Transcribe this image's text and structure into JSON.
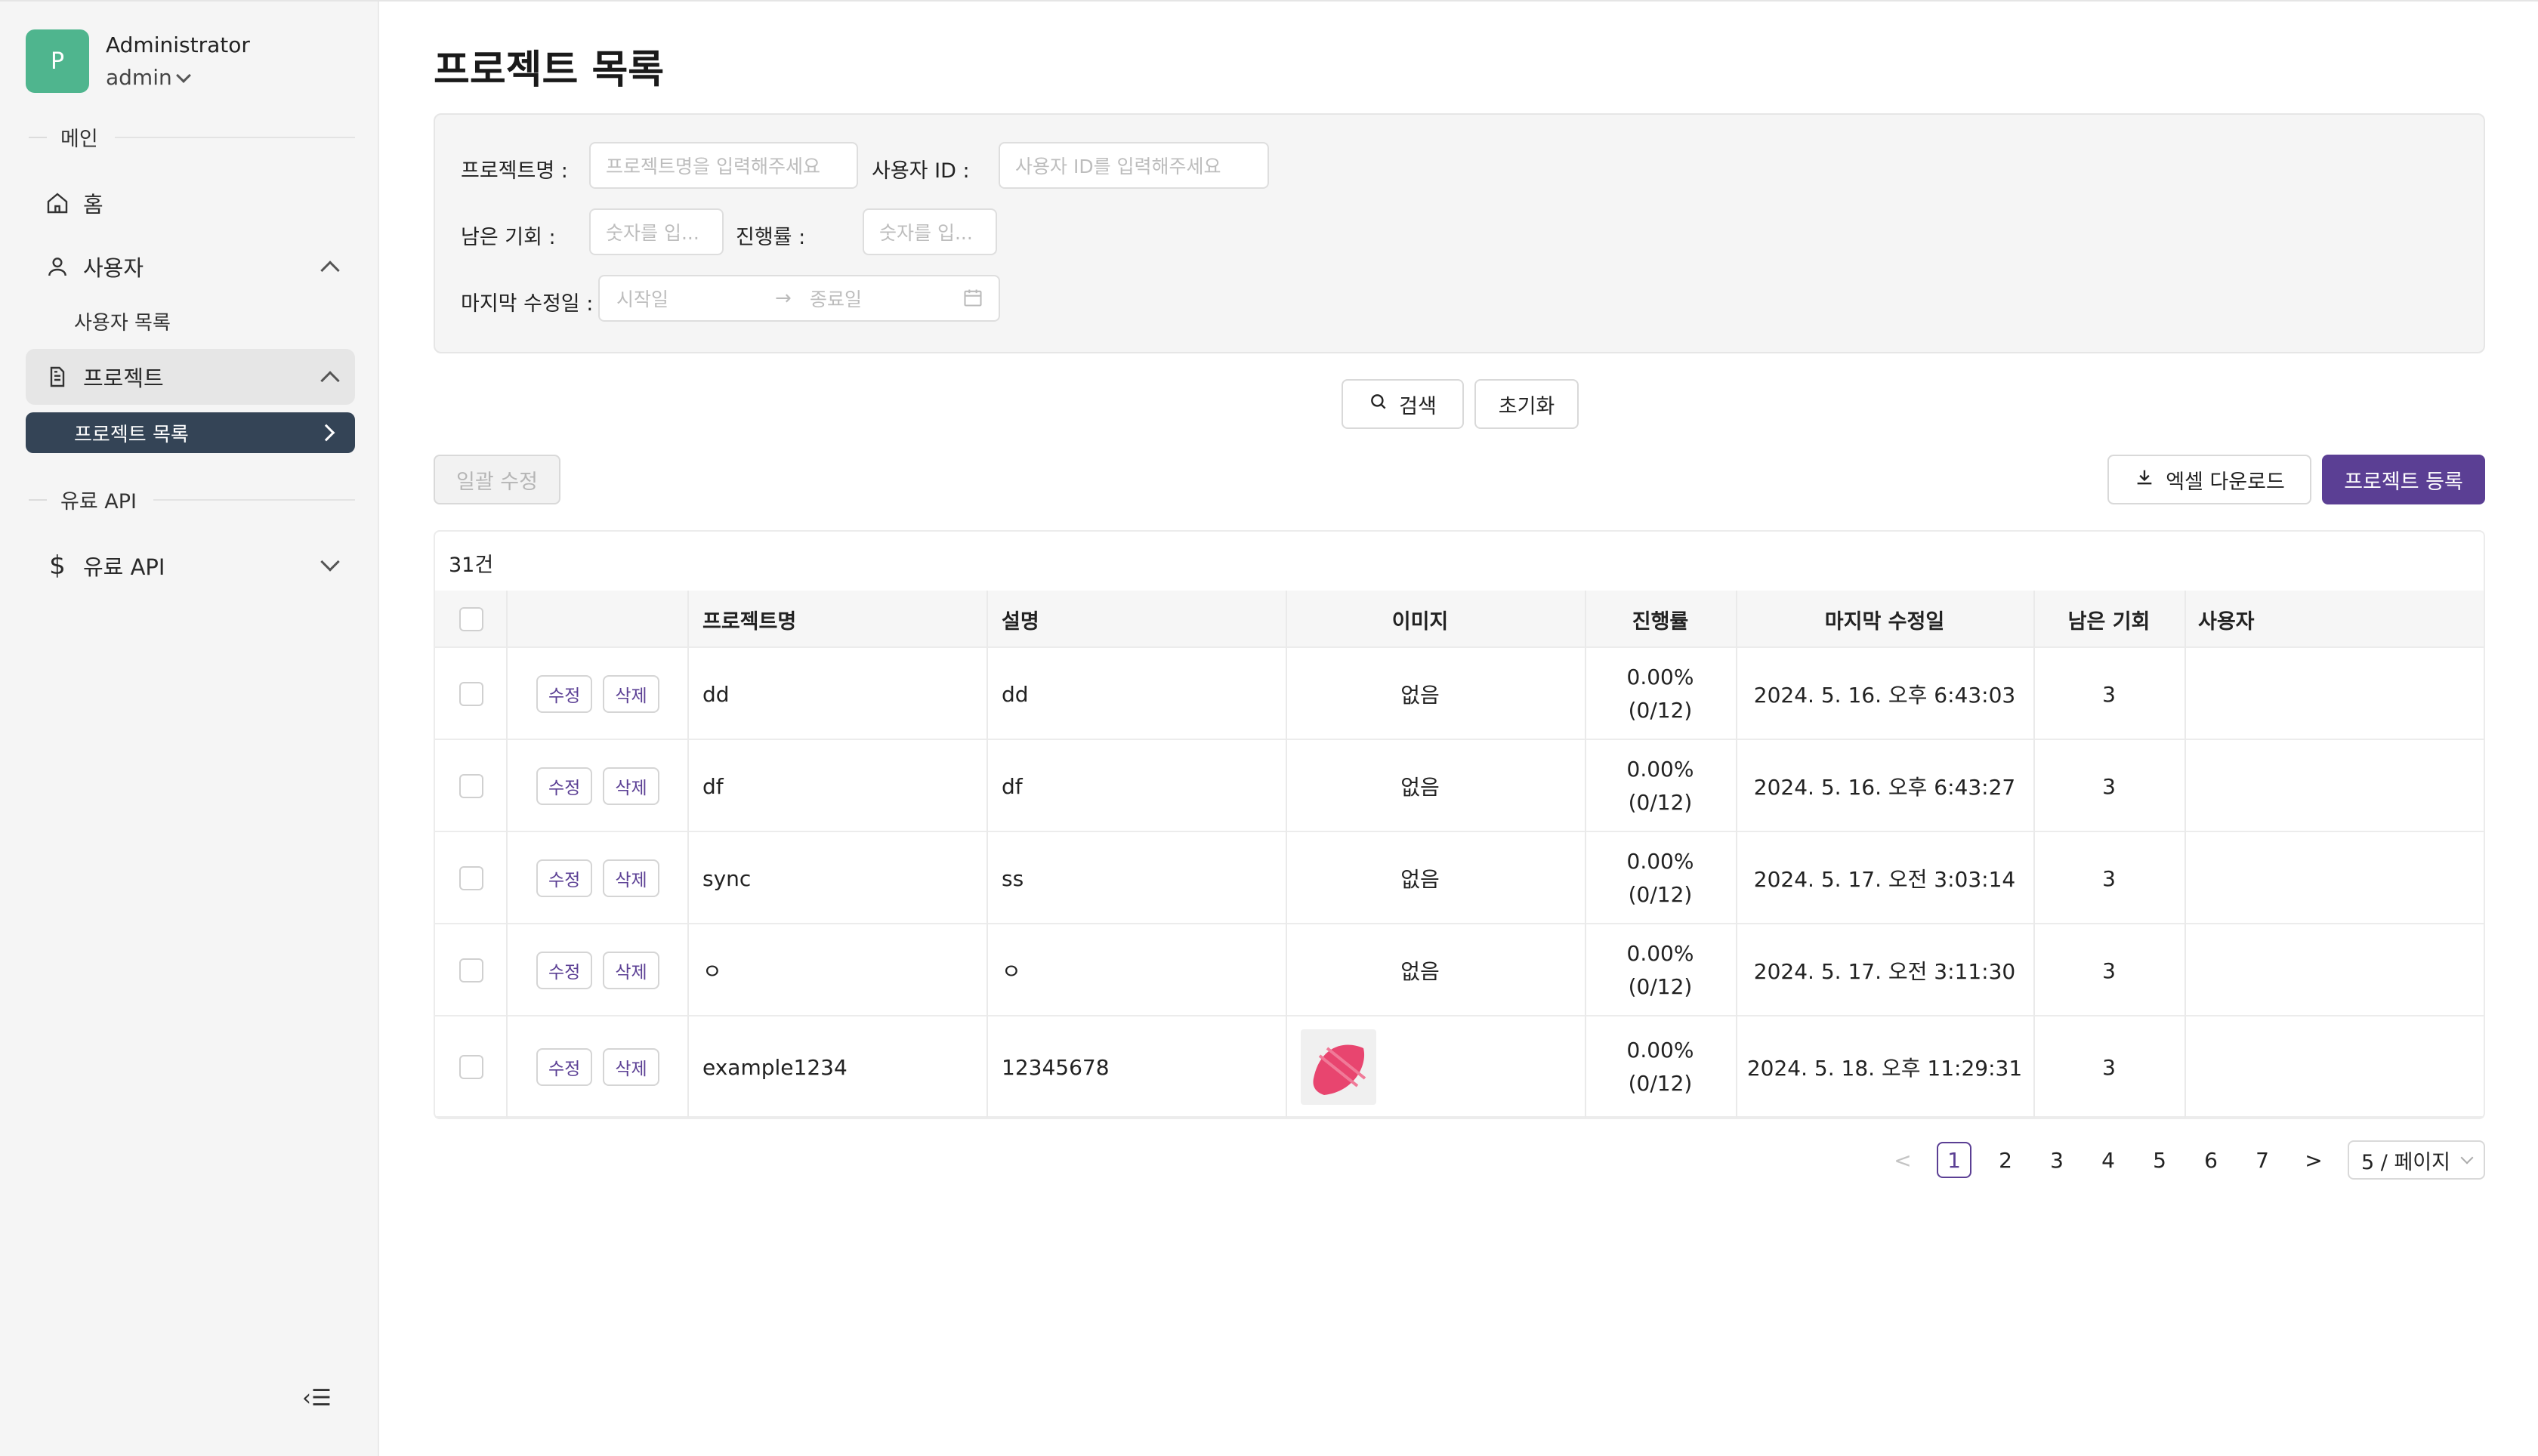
{
  "sidebar": {
    "avatar_letter": "P",
    "user_name": "Administrator",
    "user_id": "admin",
    "groups": {
      "main": "메인",
      "paid_api": "유료 API"
    },
    "items": {
      "home": "홈",
      "users": "사용자",
      "user_list": "사용자 목록",
      "projects": "프로젝트",
      "project_list": "프로젝트 목록",
      "paid_api": "유료 API"
    },
    "collapse_label": "‹☰"
  },
  "page": {
    "title": "프로젝트 목록"
  },
  "filters": {
    "project_name_label": "프로젝트명 :",
    "project_name_placeholder": "프로젝트명을 입력해주세요",
    "user_id_label": "사용자 ID :",
    "user_id_placeholder": "사용자 ID를 입력해주세요",
    "remaining_label": "남은 기회 :",
    "remaining_placeholder": "숫자를 입...",
    "progress_label": "진행률 :",
    "progress_placeholder": "숫자를 입...",
    "modified_label": "마지막 수정일 :",
    "start_placeholder": "시작일",
    "end_placeholder": "종료일"
  },
  "actions": {
    "search": "검색",
    "reset": "초기화",
    "bulk_edit": "일괄 수정",
    "excel_download": "엑셀 다운로드",
    "register": "프로젝트 등록"
  },
  "table": {
    "count": "31건",
    "columns": [
      "프로젝트명",
      "설명",
      "이미지",
      "진행률",
      "마지막 수정일",
      "남은 기회",
      "사용자"
    ],
    "edit_label": "수정",
    "delete_label": "삭제",
    "rows": [
      {
        "name": "dd",
        "desc": "dd",
        "image": "없음",
        "progress_pct": "0.00%",
        "progress_ratio": "(0/12)",
        "modified": "2024. 5. 16. 오후 6:43:03",
        "remaining": "3",
        "user": ""
      },
      {
        "name": "df",
        "desc": "df",
        "image": "없음",
        "progress_pct": "0.00%",
        "progress_ratio": "(0/12)",
        "modified": "2024. 5. 16. 오후 6:43:27",
        "remaining": "3",
        "user": ""
      },
      {
        "name": "sync",
        "desc": "ss",
        "image": "없음",
        "progress_pct": "0.00%",
        "progress_ratio": "(0/12)",
        "modified": "2024. 5. 17. 오전 3:03:14",
        "remaining": "3",
        "user": ""
      },
      {
        "name": "ㅇ",
        "desc": "ㅇ",
        "image": "없음",
        "progress_pct": "0.00%",
        "progress_ratio": "(0/12)",
        "modified": "2024. 5. 17. 오전 3:11:30",
        "remaining": "3",
        "user": ""
      },
      {
        "name": "example1234",
        "desc": "12345678",
        "image": "",
        "progress_pct": "0.00%",
        "progress_ratio": "(0/12)",
        "modified": "2024. 5. 18. 오후 11:29:31",
        "remaining": "3",
        "user": ""
      }
    ]
  },
  "pagination": {
    "prev": "<",
    "pages": [
      "1",
      "2",
      "3",
      "4",
      "5",
      "6",
      "7"
    ],
    "current": "1",
    "next": ">",
    "page_size": "5 / 페이지"
  },
  "colors": {
    "accent": "#5b3f94",
    "active_nav": "#344456",
    "avatar": "#4fb58e",
    "thumbnail": "#e8456f"
  }
}
